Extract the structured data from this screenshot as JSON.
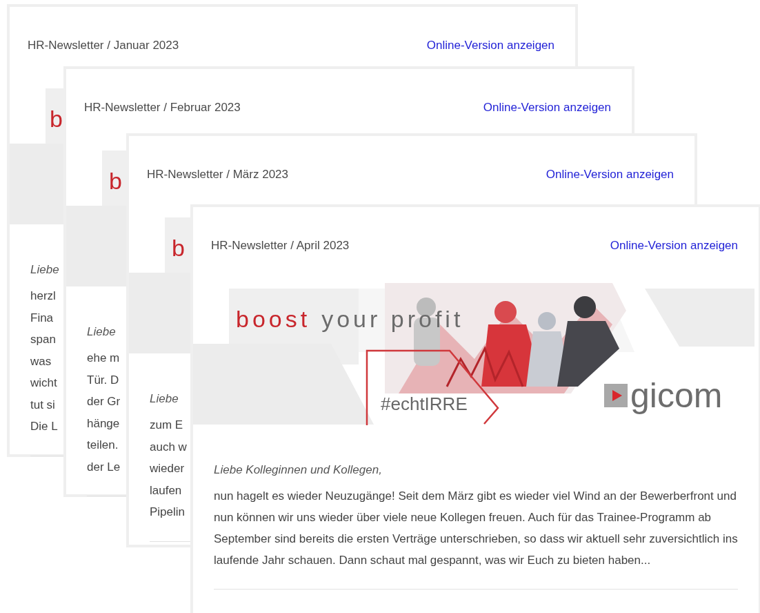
{
  "newsletters": [
    {
      "kind": "covered",
      "title": "HR-Newsletter / Januar 2023",
      "link": "Online-Version anzeigen",
      "banner": {
        "headline_accent": "b"
      },
      "greeting": "Liebe",
      "body_lines": [
        "herzl",
        "Fina",
        "span",
        "was",
        "wicht",
        "tut si",
        "Die L"
      ]
    },
    {
      "kind": "covered",
      "title": "HR-Newsletter / Februar 2023",
      "link": "Online-Version anzeigen",
      "banner": {
        "headline_accent": "b"
      },
      "greeting": "Liebe",
      "body_lines": [
        "ehe m",
        "Tür. D",
        "der Gr",
        "hänge",
        "teilen.",
        "der Le"
      ]
    },
    {
      "kind": "covered",
      "title": "HR-Newsletter / März 2023",
      "link": "Online-Version anzeigen",
      "banner": {
        "headline_accent": "b"
      },
      "greeting": "Liebe",
      "body_lines": [
        "zum E",
        "auch w",
        "wieder",
        "laufen",
        "Pipelin"
      ]
    },
    {
      "kind": "full",
      "title": "HR-Newsletter / April 2023",
      "link": "Online-Version anzeigen",
      "banner": {
        "headline_accent": "boost",
        "headline_rest": "your profit",
        "hashtag": "#echtIRRE",
        "logo": "gicom"
      },
      "greeting": "Liebe Kolleginnen und Kollegen,",
      "body": "nun hagelt es wieder Neuzugänge! Seit dem März gibt es wieder viel Wind an der Bewerberfront und nun können wir uns wieder über viele neue Kollegen freuen. Auch für das Trainee-Programm ab September sind bereits die ersten Verträge unterschrieben, so dass wir aktuell sehr zuversichtlich ins laufende Jahr schauen. Dann schaut mal gespannt, was wir Euch zu bieten haben..."
    }
  ]
}
